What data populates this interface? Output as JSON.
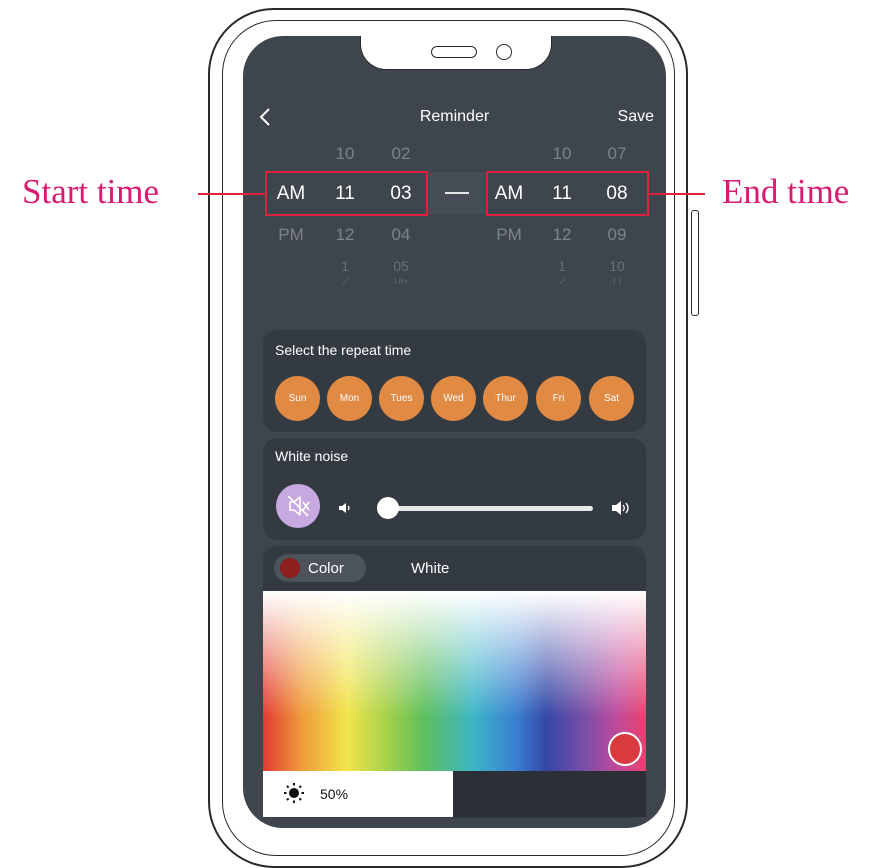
{
  "header": {
    "title": "Reminder",
    "save_label": "Save"
  },
  "start_picker": {
    "ampm": {
      "faint_top": "",
      "selected": "AM",
      "below": "PM"
    },
    "hours": {
      "above": "10",
      "selected": "11",
      "below": "12",
      "below2": "1",
      "below3": "2"
    },
    "minutes": {
      "above": "02",
      "selected": "03",
      "below": "04",
      "below2": "05",
      "below3": "06"
    }
  },
  "end_picker": {
    "ampm": {
      "selected": "AM",
      "below": "PM"
    },
    "hours": {
      "above": "10",
      "selected": "11",
      "below": "12",
      "below2": "1",
      "below3": "2"
    },
    "minutes": {
      "above": "07",
      "selected": "08",
      "below": "09",
      "below2": "10",
      "below3": "11"
    }
  },
  "repeat": {
    "title": "Select the repeat time",
    "days": [
      "Sun",
      "Mon",
      "Tues",
      "Wed",
      "Thur",
      "Fri",
      "Sat"
    ]
  },
  "white_noise": {
    "title": "White noise",
    "volume": 0.0
  },
  "light": {
    "tab_color": "Color",
    "tab_white": "White",
    "selected_color": "#8c1e1e",
    "brightness": "50%"
  },
  "annotations": {
    "start": "Start time",
    "end": "End time"
  },
  "colors": {
    "screen_bg": "#3f454c",
    "card_bg": "#343a41",
    "day_orange": "#e08a44",
    "annot_pink": "#d81b70",
    "highlight_red": "#e0203c"
  }
}
